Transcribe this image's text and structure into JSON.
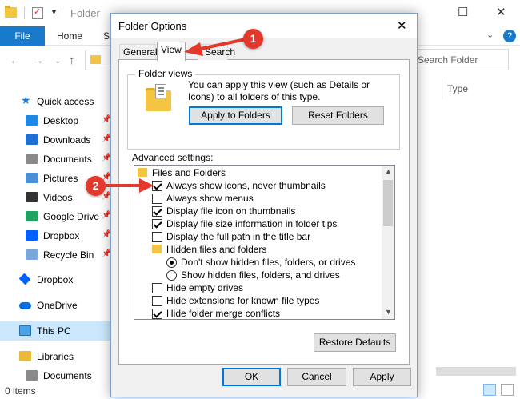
{
  "explorer": {
    "title": "Folder",
    "ribbon_tabs": {
      "file": "File",
      "home": "Home",
      "share": "Sh"
    },
    "help": "?",
    "search_placeholder": "Search Folder",
    "column_type": "Type",
    "sidebar": {
      "quick_access": "Quick access",
      "items": [
        {
          "label": "Desktop",
          "color": "#1e88e5"
        },
        {
          "label": "Downloads",
          "color": "#1e6fd6"
        },
        {
          "label": "Documents",
          "color": "#8a8a8a"
        },
        {
          "label": "Pictures",
          "color": "#4a90d9"
        },
        {
          "label": "Videos",
          "color": "#333333"
        },
        {
          "label": "Google Drive",
          "color": "#1ea362"
        },
        {
          "label": "Dropbox",
          "color": "#0061fe"
        },
        {
          "label": "Recycle Bin",
          "color": "#7aa7d9"
        }
      ],
      "dropbox": "Dropbox",
      "onedrive": "OneDrive",
      "this_pc": "This PC",
      "libraries": "Libraries",
      "documents": "Documents"
    },
    "status": "0 items"
  },
  "dialog": {
    "title": "Folder Options",
    "tabs": {
      "general": "General",
      "view": "View",
      "search": "Search"
    },
    "folder_views": {
      "legend": "Folder views",
      "description": "You can apply this view (such as Details or Icons) to all folders of this type.",
      "apply_button": "Apply to Folders",
      "reset_button": "Reset Folders"
    },
    "advanced_label": "Advanced settings:",
    "tree": [
      {
        "kind": "folder",
        "label": "Files and Folders",
        "indent": 0
      },
      {
        "kind": "checkbox",
        "label": "Always show icons, never thumbnails",
        "checked": true,
        "indent": 1
      },
      {
        "kind": "checkbox",
        "label": "Always show menus",
        "checked": false,
        "indent": 1
      },
      {
        "kind": "checkbox",
        "label": "Display file icon on thumbnails",
        "checked": true,
        "indent": 1
      },
      {
        "kind": "checkbox",
        "label": "Display file size information in folder tips",
        "checked": true,
        "indent": 1
      },
      {
        "kind": "checkbox",
        "label": "Display the full path in the title bar",
        "checked": false,
        "indent": 1
      },
      {
        "kind": "folder",
        "label": "Hidden files and folders",
        "indent": 1
      },
      {
        "kind": "radio",
        "label": "Don't show hidden files, folders, or drives",
        "checked": true,
        "indent": 2
      },
      {
        "kind": "radio",
        "label": "Show hidden files, folders, and drives",
        "checked": false,
        "indent": 2
      },
      {
        "kind": "checkbox",
        "label": "Hide empty drives",
        "checked": false,
        "indent": 1
      },
      {
        "kind": "checkbox",
        "label": "Hide extensions for known file types",
        "checked": false,
        "indent": 1
      },
      {
        "kind": "checkbox",
        "label": "Hide folder merge conflicts",
        "checked": true,
        "indent": 1
      }
    ],
    "restore_button": "Restore Defaults",
    "ok_button": "OK",
    "cancel_button": "Cancel",
    "apply_button": "Apply"
  },
  "annotations": {
    "badge1": "1",
    "badge2": "2",
    "color": "#e3382b"
  }
}
